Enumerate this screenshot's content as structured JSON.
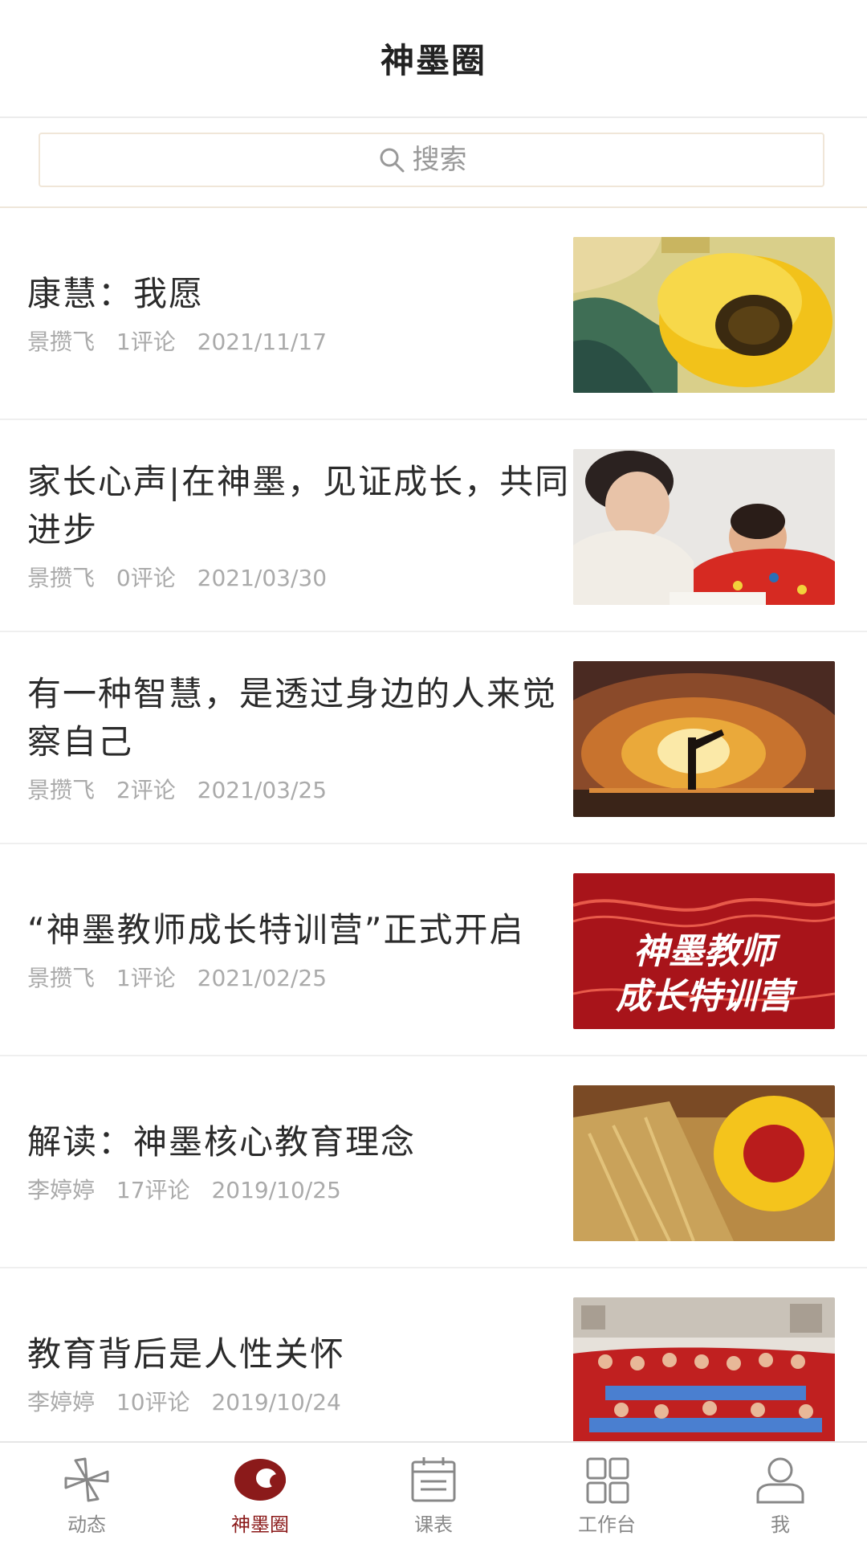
{
  "header": {
    "title": "神墨圈"
  },
  "search": {
    "placeholder": "搜索"
  },
  "articles": [
    {
      "title": "康慧：我愿",
      "author": "景攒飞",
      "comments": "1评论",
      "date": "2021/11/17"
    },
    {
      "title": "家长心声|在神墨，见证成长，共同进步",
      "author": "景攒飞",
      "comments": "0评论",
      "date": "2021/03/30"
    },
    {
      "title": "有一种智慧，是透过身边的人来觉察自己",
      "author": "景攒飞",
      "comments": "2评论",
      "date": "2021/03/25"
    },
    {
      "title": "“神墨教师成长特训营”正式开启",
      "author": "景攒飞",
      "comments": "1评论",
      "date": "2021/02/25",
      "thumb_text": [
        "神墨教师",
        "成长特训营"
      ]
    },
    {
      "title": "解读：神墨核心教育理念",
      "author": "李婷婷",
      "comments": "17评论",
      "date": "2019/10/25"
    },
    {
      "title": "教育背后是人性关怀",
      "author": "李婷婷",
      "comments": "10评论",
      "date": "2019/10/24"
    }
  ],
  "tabs": [
    {
      "label": "动态",
      "icon": "pinwheel-icon"
    },
    {
      "label": "神墨圈",
      "icon": "circle-icon",
      "active": true
    },
    {
      "label": "课表",
      "icon": "calendar-icon"
    },
    {
      "label": "工作台",
      "icon": "grid-icon"
    },
    {
      "label": "我",
      "icon": "user-icon"
    }
  ],
  "colors": {
    "accent": "#8b1a1a",
    "inactive": "#888888"
  }
}
